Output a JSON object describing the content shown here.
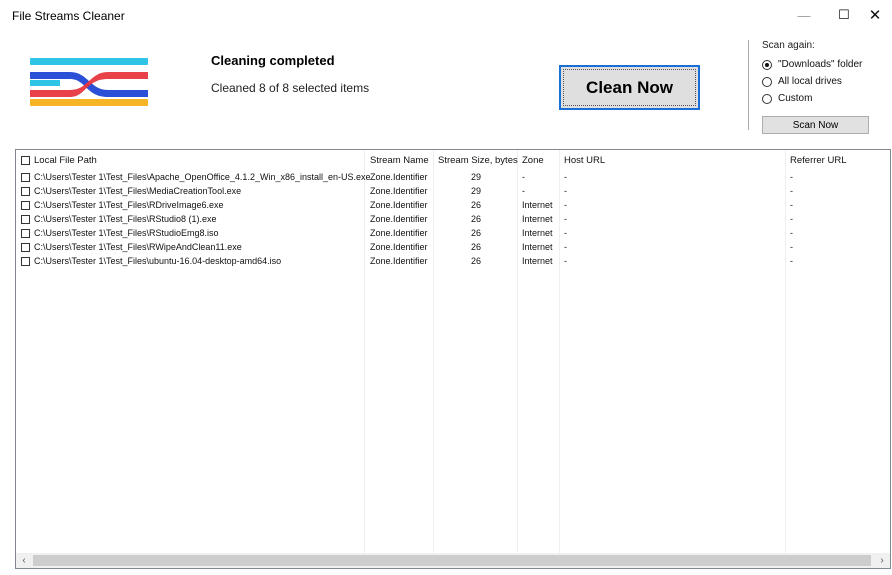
{
  "window": {
    "title": "File Streams Cleaner",
    "minimize": "—",
    "maximize": "☐",
    "close": "✕"
  },
  "logo": {
    "colors": [
      "#2ec4e6",
      "#2b4fd6",
      "#e8373f",
      "#f6b427"
    ]
  },
  "status": {
    "title": "Cleaning completed",
    "subtitle": "Cleaned 8 of 8 selected items"
  },
  "clean_button": "Clean Now",
  "scan": {
    "label": "Scan again:",
    "options": [
      {
        "label": "\"Downloads\" folder",
        "selected": true
      },
      {
        "label": "All local drives",
        "selected": false
      },
      {
        "label": "Custom",
        "selected": false
      }
    ],
    "button": "Scan Now"
  },
  "table": {
    "headers": [
      "Local File Path",
      "Stream Name",
      "Stream Size, bytes",
      "Zone",
      "Host URL",
      "Referrer URL"
    ],
    "rows": [
      [
        "C:\\Users\\Tester 1\\Test_Files\\Apache_OpenOffice_4.1.2_Win_x86_install_en-US.exe",
        "Zone.Identifier",
        "29",
        "-",
        "-",
        "-"
      ],
      [
        "C:\\Users\\Tester 1\\Test_Files\\MediaCreationTool.exe",
        "Zone.Identifier",
        "29",
        "-",
        "-",
        "-"
      ],
      [
        "C:\\Users\\Tester 1\\Test_Files\\RDriveImage6.exe",
        "Zone.Identifier",
        "26",
        "Internet",
        "-",
        "-"
      ],
      [
        "C:\\Users\\Tester 1\\Test_Files\\RStudio8 (1).exe",
        "Zone.Identifier",
        "26",
        "Internet",
        "-",
        "-"
      ],
      [
        "C:\\Users\\Tester 1\\Test_Files\\RStudioEmg8.iso",
        "Zone.Identifier",
        "26",
        "Internet",
        "-",
        "-"
      ],
      [
        "C:\\Users\\Tester 1\\Test_Files\\RWipeAndClean11.exe",
        "Zone.Identifier",
        "26",
        "Internet",
        "-",
        "-"
      ],
      [
        "C:\\Users\\Tester 1\\Test_Files\\ubuntu-16.04-desktop-amd64.iso",
        "Zone.Identifier",
        "26",
        "Internet",
        "-",
        "-"
      ]
    ]
  },
  "scrollbar": {
    "left": "‹",
    "right": "›"
  }
}
